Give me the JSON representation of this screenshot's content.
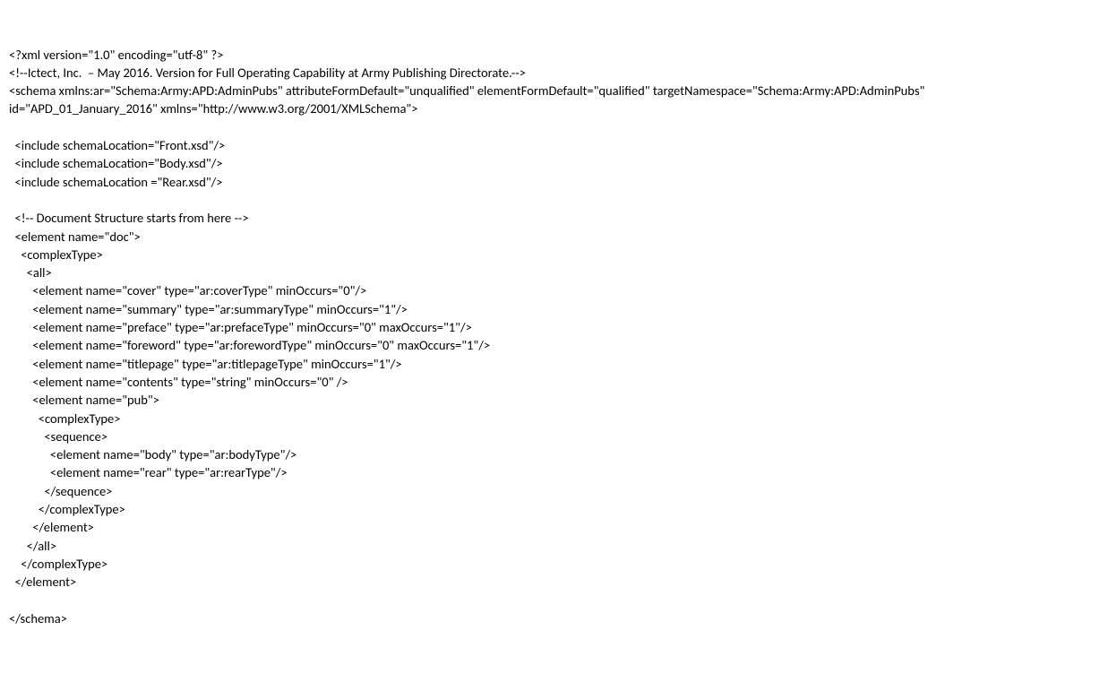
{
  "lines": [
    "<?xml version=\"1.0\" encoding=\"utf-8\" ?>",
    "<!--Ictect, Inc.  – May 2016. Version for Full Operating Capability at Army Publishing Directorate.-->",
    "<schema xmlns:ar=\"Schema:Army:APD:AdminPubs\" attributeFormDefault=\"unqualified\" elementFormDefault=\"qualified\" targetNamespace=\"Schema:Army:APD:AdminPubs\"",
    "id=\"APD_01_January_2016\" xmlns=\"http://www.w3.org/2001/XMLSchema\">",
    "",
    "  <include schemaLocation=\"Front.xsd\"/>",
    "  <include schemaLocation=\"Body.xsd\"/>",
    "  <include schemaLocation =\"Rear.xsd\"/>",
    "",
    "  <!-- Document Structure starts from here -->",
    "  <element name=\"doc\">",
    "    <complexType>",
    "      <all>",
    "        <element name=\"cover\" type=\"ar:coverType\" minOccurs=\"0\"/>",
    "        <element name=\"summary\" type=\"ar:summaryType\" minOccurs=\"1\"/>",
    "        <element name=\"preface\" type=\"ar:prefaceType\" minOccurs=\"0\" maxOccurs=\"1\"/>",
    "        <element name=\"foreword\" type=\"ar:forewordType\" minOccurs=\"0\" maxOccurs=\"1\"/>",
    "        <element name=\"titlepage\" type=\"ar:titlepageType\" minOccurs=\"1\"/>",
    "        <element name=\"contents\" type=\"string\" minOccurs=\"0\" />",
    "        <element name=\"pub\">",
    "          <complexType>",
    "            <sequence>",
    "              <element name=\"body\" type=\"ar:bodyType\"/>",
    "              <element name=\"rear\" type=\"ar:rearType\"/>",
    "            </sequence>",
    "          </complexType>",
    "        </element>",
    "      </all>",
    "    </complexType>",
    "  </element>",
    "",
    "</schema>"
  ]
}
